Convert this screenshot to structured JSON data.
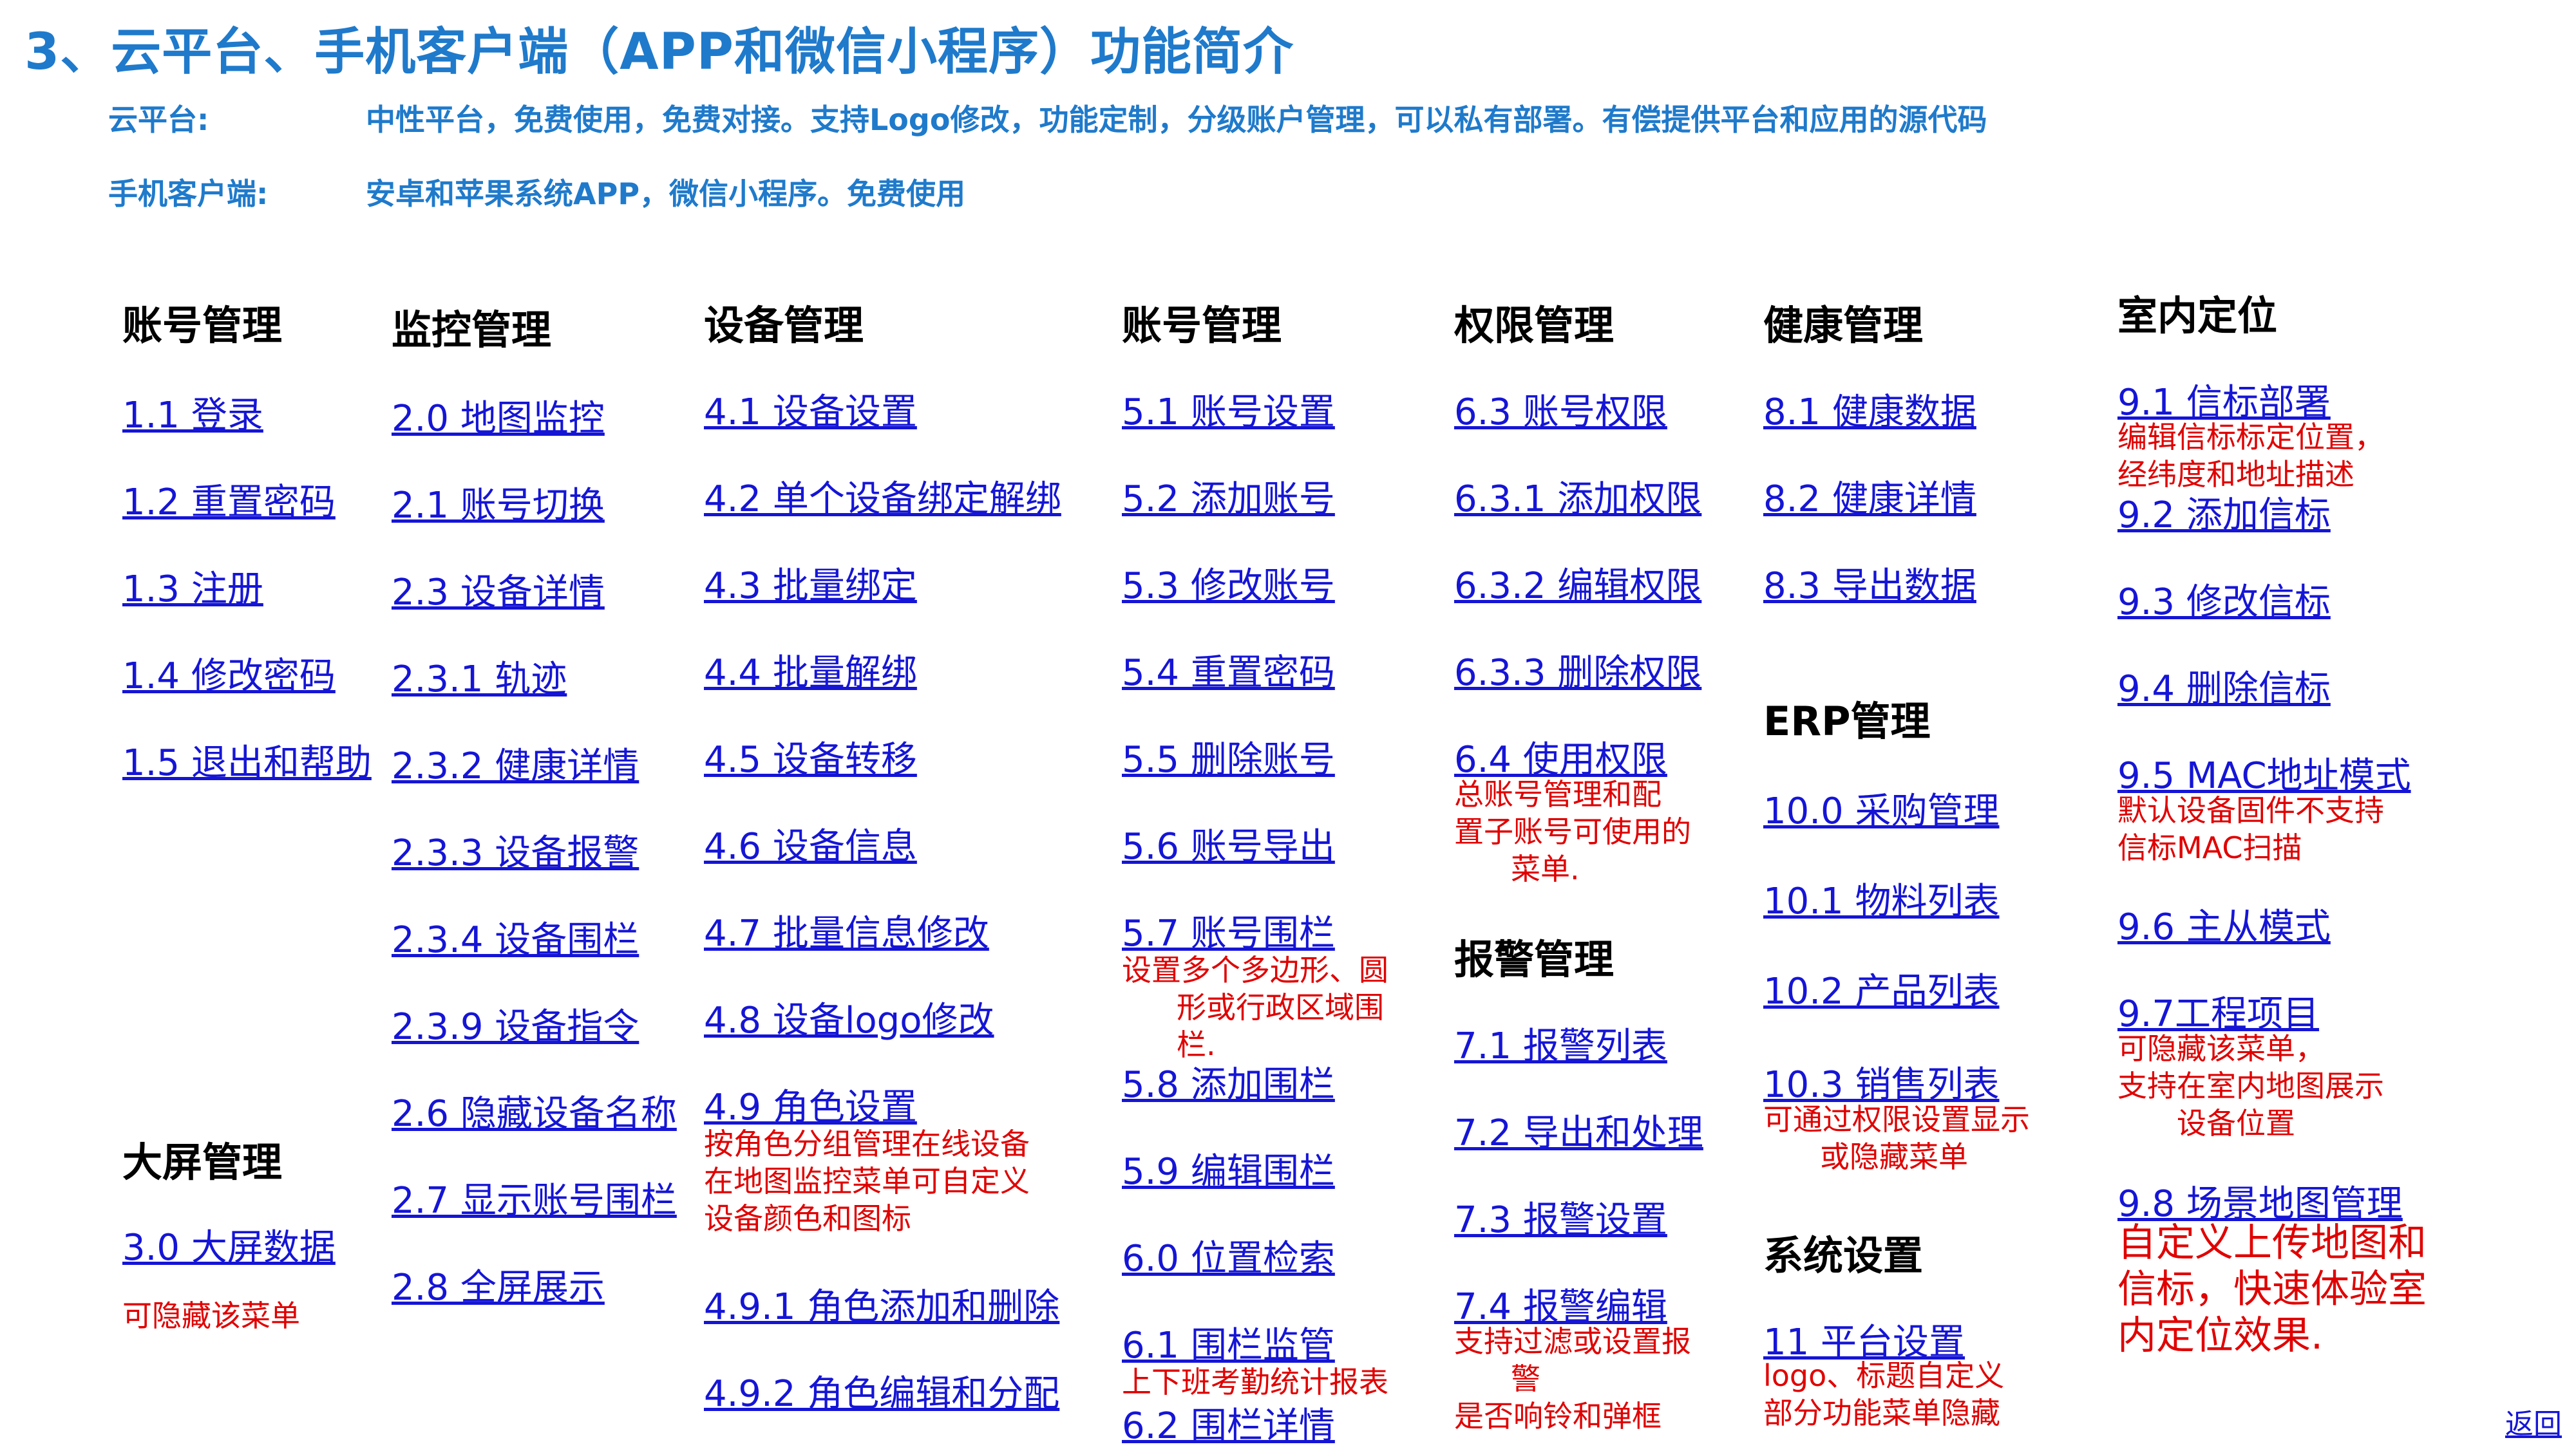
{
  "title": "3、云平台、手机客户端（APP和微信小程序）功能简介",
  "intro": [
    {
      "label": "云平台:",
      "text": "中性平台，免费使用，免费对接。支持Logo修改，功能定制，分级账户管理，可以私有部署。有偿提供平台和应用的源代码"
    },
    {
      "label": "手机客户端:",
      "text": "安卓和苹果系统APP，微信小程序。免费使用"
    }
  ],
  "sections": {
    "account1": {
      "title": "账号管理",
      "items": [
        "1.1 登录",
        "1.2 重置密码",
        "1.3 注册",
        "1.4 修改密码",
        "1.5 退出和帮助"
      ]
    },
    "bigscreen": {
      "title": "大屏管理",
      "items": [
        "3.0 大屏数据"
      ],
      "note": "可隐藏该菜单"
    },
    "monitor": {
      "title": "监控管理",
      "items": [
        "2.0 地图监控",
        "2.1 账号切换",
        "2.3 设备详情",
        "2.3.1 轨迹",
        "2.3.2 健康详情",
        "2.3.3 设备报警",
        "2.3.4 设备围栏",
        "2.3.9 设备指令",
        "2.6 隐藏设备名称",
        "2.7 显示账号围栏",
        "2.8 全屏展示"
      ]
    },
    "device": {
      "title": "设备管理",
      "items": [
        "4.1 设备设置",
        "4.2 单个设备绑定解绑",
        "4.3 批量绑定",
        "4.4 批量解绑",
        "4.5 设备转移",
        "4.6 设备信息",
        "4.7 批量信息修改",
        "4.8 设备logo修改",
        "4.9 角色设置",
        "4.9.1 角色添加和删除",
        "4.9.2 角色编辑和分配"
      ],
      "note_role": [
        "按角色分组管理在线设备",
        "在地图监控菜单可自定义",
        "设备颜色和图标"
      ]
    },
    "account2": {
      "title": "账号管理",
      "items": [
        "5.1 账号设置",
        "5.2 添加账号",
        "5.3 修改账号",
        "5.4 重置密码",
        "5.5 删除账号",
        "5.6 账号导出",
        "5.7 账号围栏",
        "5.8 添加围栏",
        "5.9 编辑围栏",
        "6.0 位置检索",
        "6.1 围栏监管",
        "6.2 围栏详情"
      ],
      "note_fence": [
        "设置多个多边形、圆",
        "形或行政区域围",
        "栏."
      ],
      "note_supervise": "上下班考勤统计报表"
    },
    "permission": {
      "title": "权限管理",
      "items": [
        "6.3 账号权限",
        "6.3.1 添加权限",
        "6.3.2 编辑权限",
        "6.3.3 删除权限",
        "6.4 使用权限"
      ],
      "note_use": [
        "总账号管理和配",
        "置子账号可使用的",
        "菜单."
      ]
    },
    "alarm": {
      "title": "报警管理",
      "items": [
        "7.1 报警列表",
        "7.2 导出和处理",
        "7.3 报警设置",
        "7.4 报警编辑"
      ],
      "note_edit": [
        "支持过滤或设置报",
        "警",
        "是否响铃和弹框"
      ]
    },
    "health": {
      "title": "健康管理",
      "items": [
        "8.1 健康数据",
        "8.2 健康详情",
        "8.3 导出数据"
      ]
    },
    "erp": {
      "title": "ERP管理",
      "items": [
        "10.0 采购管理",
        "10.1 物料列表",
        "10.2 产品列表",
        "10.3 销售列表"
      ],
      "note_sales": [
        "可通过权限设置显示",
        "或隐藏菜单"
      ]
    },
    "system": {
      "title": "系统设置",
      "items": [
        "11 平台设置"
      ],
      "note": [
        "logo、标题自定义",
        "部分功能菜单隐藏"
      ]
    },
    "indoor": {
      "title": "室内定位",
      "items": [
        "9.1 信标部署",
        "9.2 添加信标",
        "9.3 修改信标",
        "9.4 删除信标",
        "9.5 MAC地址模式",
        "9.6 主从模式",
        "9.7工程项目",
        "9.8 场景地图管理"
      ],
      "note_deploy": [
        "编辑信标标定位置，",
        "经纬度和地址描述"
      ],
      "note_mac": [
        "默认设备固件不支持",
        "信标MAC扫描"
      ],
      "note_project": [
        "可隐藏该菜单，",
        "支持在室内地图展示",
        "设备位置"
      ],
      "note_scene": [
        "自定义上传地图和",
        "信标，快速体验室",
        "内定位效果."
      ]
    }
  },
  "back_label": "返回"
}
